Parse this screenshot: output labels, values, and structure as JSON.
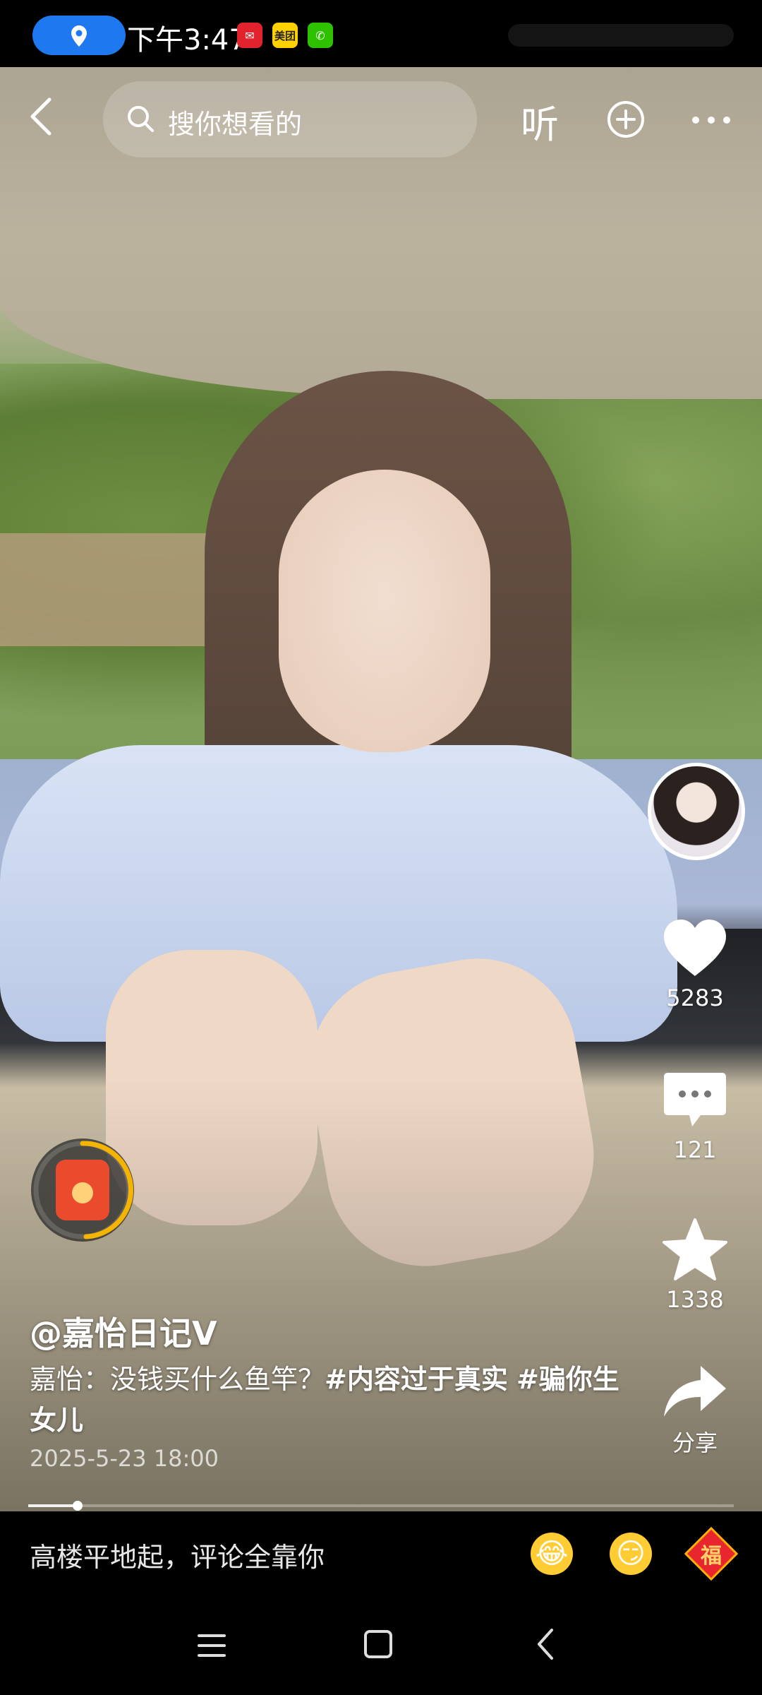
{
  "status_bar": {
    "time": "下午3:47",
    "app_icons": [
      {
        "name": "red-app-icon",
        "glyph": "✉"
      },
      {
        "name": "meituan-icon",
        "glyph": "美团"
      },
      {
        "name": "wechat-icon",
        "glyph": "✆"
      }
    ]
  },
  "top_nav": {
    "search_placeholder": "搜你想看的",
    "listen_label": "听"
  },
  "rail": {
    "likes": "5283",
    "comments": "121",
    "favorites": "1338",
    "share_label": "分享"
  },
  "caption": {
    "author": "@嘉怡日记V",
    "text": "嘉怡：没钱买什么鱼竿？",
    "tag1": "#内容过于真实",
    "tag2": "#骗你生女儿",
    "date": "2025-5-23 18:00"
  },
  "progress": {
    "fraction": 0.07
  },
  "comment_bar": {
    "placeholder": "高楼平地起，评论全靠你",
    "emojis": [
      "😂",
      "😏"
    ],
    "fu_label": "福"
  },
  "colors": {
    "location_pill": "#1e78f0",
    "redpacket_ring": "#f5b400"
  }
}
